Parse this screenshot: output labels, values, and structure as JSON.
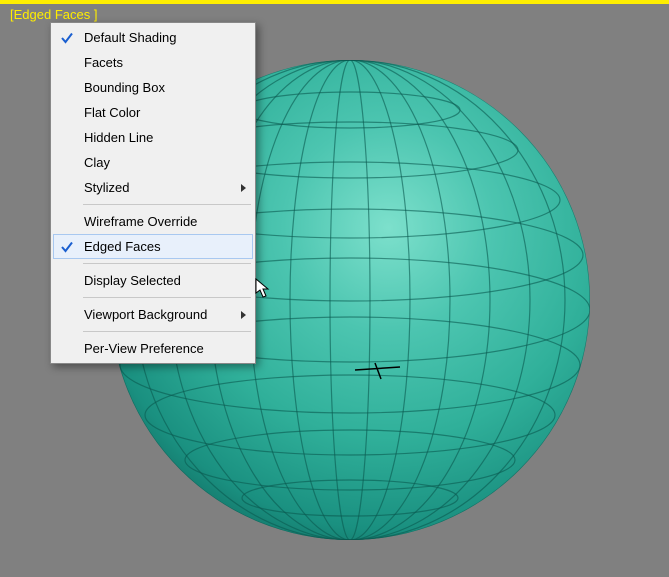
{
  "viewport": {
    "label_prefix": "[",
    "label_text": "Edged Faces",
    "label_suffix": " ]"
  },
  "menu": {
    "items": [
      {
        "label": "Default Shading",
        "checked": true,
        "submenu": false
      },
      {
        "label": "Facets",
        "checked": false,
        "submenu": false
      },
      {
        "label": "Bounding Box",
        "checked": false,
        "submenu": false
      },
      {
        "label": "Flat Color",
        "checked": false,
        "submenu": false
      },
      {
        "label": "Hidden Line",
        "checked": false,
        "submenu": false
      },
      {
        "label": "Clay",
        "checked": false,
        "submenu": false
      },
      {
        "label": "Stylized",
        "checked": false,
        "submenu": true
      }
    ],
    "items2": [
      {
        "label": "Wireframe Override",
        "checked": false,
        "submenu": false
      },
      {
        "label": "Edged Faces",
        "checked": true,
        "submenu": false,
        "hover": true
      }
    ],
    "items3": [
      {
        "label": "Display Selected",
        "checked": false,
        "submenu": false
      }
    ],
    "items4": [
      {
        "label": "Viewport Background",
        "checked": false,
        "submenu": true
      }
    ],
    "items5": [
      {
        "label": "Per-View Preference",
        "checked": false,
        "submenu": false
      }
    ]
  }
}
